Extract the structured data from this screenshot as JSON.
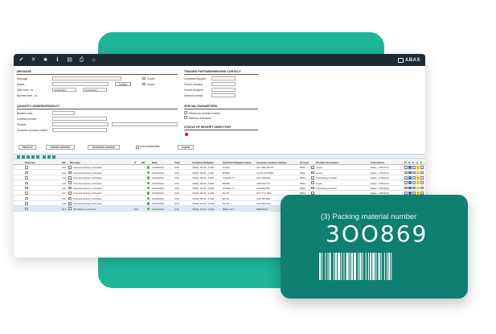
{
  "window": {
    "brand": "ABAS"
  },
  "toolbar": {
    "icons": [
      "check-icon",
      "close-icon",
      "save-icon",
      "info-icon",
      "list-icon",
      "print-icon",
      "home-icon"
    ]
  },
  "form": {
    "message": {
      "title": "MESSAGE",
      "message_label": "Message",
      "status_label": "Status",
      "status_button": "Update",
      "export_label": "Export",
      "import_label": "Import",
      "date_from_label": "Date from - to",
      "date_from": "21/06/2021",
      "date_to": "21/06/2021",
      "number_label": "Number from - to"
    },
    "quantity": {
      "title": "QUANTITY ORDERS/PRODUCT",
      "blanket_label": "Blanket order",
      "contract_label": "Contract number",
      "product_label": "Product",
      "customer_product_label": "Customer product number"
    },
    "trading": {
      "title": "TRADING PARTNER/INBOUND CONTACT",
      "customer_label": "Customer/Supplier",
      "goods_label": "Goods recipient",
      "invoice_label": "Invoice recipient",
      "inbound_label": "Inbound contact"
    },
    "special": {
      "title": "SPECIAL PARAMETERS",
      "search_label": "Search for product in table",
      "delivery_label": "Delivery schedules"
    },
    "status": {
      "title": "STATUS OF RECEIPT DIRECTORY"
    }
  },
  "actions": {
    "select_all": "Select all",
    "activate": "Activate selection",
    "deactivate": "Deactivate selection",
    "auto_format": "Auto format fields",
    "legend": "Legend"
  },
  "table": {
    "headers": [
      "Selection",
      "ID#",
      "Message",
      "S",
      "EB",
      "Date",
      "Time",
      "Customer/Supplier",
      "Customer/Supplier name",
      "Customer product number",
      "Product",
      "Product description",
      "Transaction",
      "Pr",
      "Q",
      "S",
      "A",
      "E"
    ],
    "rows": [
      {
        "id": "112",
        "msg": "Forecast delivery schedule",
        "date": "21/06/2021",
        "time": "0:00",
        "cust": "70001, 96-01, 4-045",
        "name": "GAAD",
        "cpn": "0/4-7900-00707",
        "prod": "8002",
        "desc": "Cover",
        "trans": "Sales - 2701/014"
      },
      {
        "id": "113",
        "msg": "Forecast delivery schedule",
        "date": "21/06/2021",
        "time": "0:00",
        "cust": "70001, 96-01, 4-045",
        "name": "BMWF",
        "cpn": "A4-P2-3270090",
        "prod": "8002",
        "desc": "Cover",
        "trans": "Sales - 2701/014"
      },
      {
        "id": "114",
        "msg": "Forecast delivery schedule",
        "date": "21/06/2021",
        "time": "0:00",
        "cust": "70001, 96-01, 4-025",
        "name": "STERN-73",
        "cpn": "A4T/100/023",
        "prod": "8002",
        "desc": "Lubricating oil drain",
        "trans": "Sales - 2701/012"
      },
      {
        "id": "115",
        "msg": "Forecast delivery schedule",
        "date": "21/06/2021",
        "time": "0:00",
        "cust": "70001, 96-01, 4-025",
        "name": "BMWF",
        "cpn": "4493*027*11",
        "prod": "8003",
        "desc": "Angle",
        "trans": "Sales - 2701/012"
      },
      {
        "id": "116",
        "msg": "Forecast delivery schedule",
        "date": "21/06/2021",
        "time": "0:00",
        "cust": "70001, 96-01, 4-025",
        "name": "STERN-73",
        "cpn": "A4/1/00/053",
        "prod": "8002",
        "desc": "Lubricating oil drain",
        "trans": "Sales - 2701/012"
      },
      {
        "id": "117",
        "msg": "Forecast delivery schedule",
        "date": "21/06/2021",
        "time": "0:00",
        "cust": "70001, 96-01, 4-04E",
        "name": "BLITZ",
        "cpn": "0/4-7777-000",
        "prod": "8002",
        "desc": "",
        "trans": "Sales - 2701/012"
      },
      {
        "id": "118",
        "msg": "Forecast delivery schedule",
        "date": "21/06/2021",
        "time": "0:00",
        "cust": "70001, 96-01, 4-04E",
        "name": "BLITZ",
        "cpn": "4/10-557000",
        "prod": "8002",
        "desc": "",
        "trans": "Sales - 2701/012"
      },
      {
        "id": "119",
        "msg": "Forecast delivery schedule",
        "date": "21/06/2021",
        "time": "0:00",
        "cust": "70001, 96-01, 4-04E",
        "name": "BLITZ",
        "cpn": "4/10-557010",
        "prod": "8002",
        "desc": "",
        "trans": "Sales - 2701/012"
      },
      {
        "id": "001",
        "msg": "JIT delivery schedule",
        "s": "001",
        "date": "21/06/2021",
        "time": "0:00",
        "cust": "70001, 96-01, 4-01E",
        "name": "BMW JIT-1",
        "cpn": "B8003A23",
        "prod": "8002",
        "desc": "",
        "trans": "",
        "selected": true
      }
    ]
  },
  "card": {
    "label": "(3) Packing material number",
    "number": "3OO869"
  },
  "colors": {
    "accent": "#1fb59a",
    "card": "#0f7f72",
    "toolbar": "#1e2a33"
  }
}
